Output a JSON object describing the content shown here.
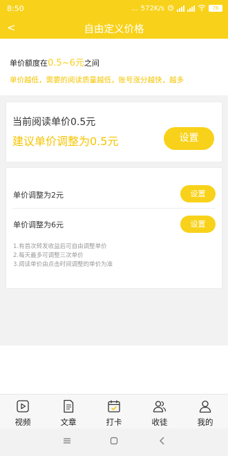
{
  "status_bar": {
    "time": "8:50",
    "dots": "...",
    "speed": "572K/s",
    "battery": "76"
  },
  "header": {
    "back_label": "<",
    "title": "自由定义价格"
  },
  "price_range": {
    "prefix": "单价额度在",
    "range": "0.5~6元",
    "suffix": "之间"
  },
  "tip": "单价越低，需要的阅读质量越低，账号涨分越快，越多",
  "current_card": {
    "current_text": "当前阅读单价0.5元",
    "suggest_text": "建议单价调整为0.5元",
    "button_label": "设置"
  },
  "options": [
    {
      "label": "单价调整为2元",
      "button_label": "设置"
    },
    {
      "label": "单价调整为6元",
      "button_label": "设置"
    }
  ],
  "notes": [
    "1.有首次转发收益后可自由调整单价",
    "2.每天最多可调整三次单价",
    "3.阅读单价由点击时间调整的单价为准"
  ],
  "tabs": [
    {
      "label": "视频",
      "icon": "video-icon"
    },
    {
      "label": "文章",
      "icon": "article-icon"
    },
    {
      "label": "打卡",
      "icon": "calendar-checkin-icon"
    },
    {
      "label": "收徒",
      "icon": "users-icon"
    },
    {
      "label": "我的",
      "icon": "profile-icon"
    }
  ],
  "colors": {
    "accent": "#f8d21a",
    "highlight_text": "#f5c400"
  }
}
